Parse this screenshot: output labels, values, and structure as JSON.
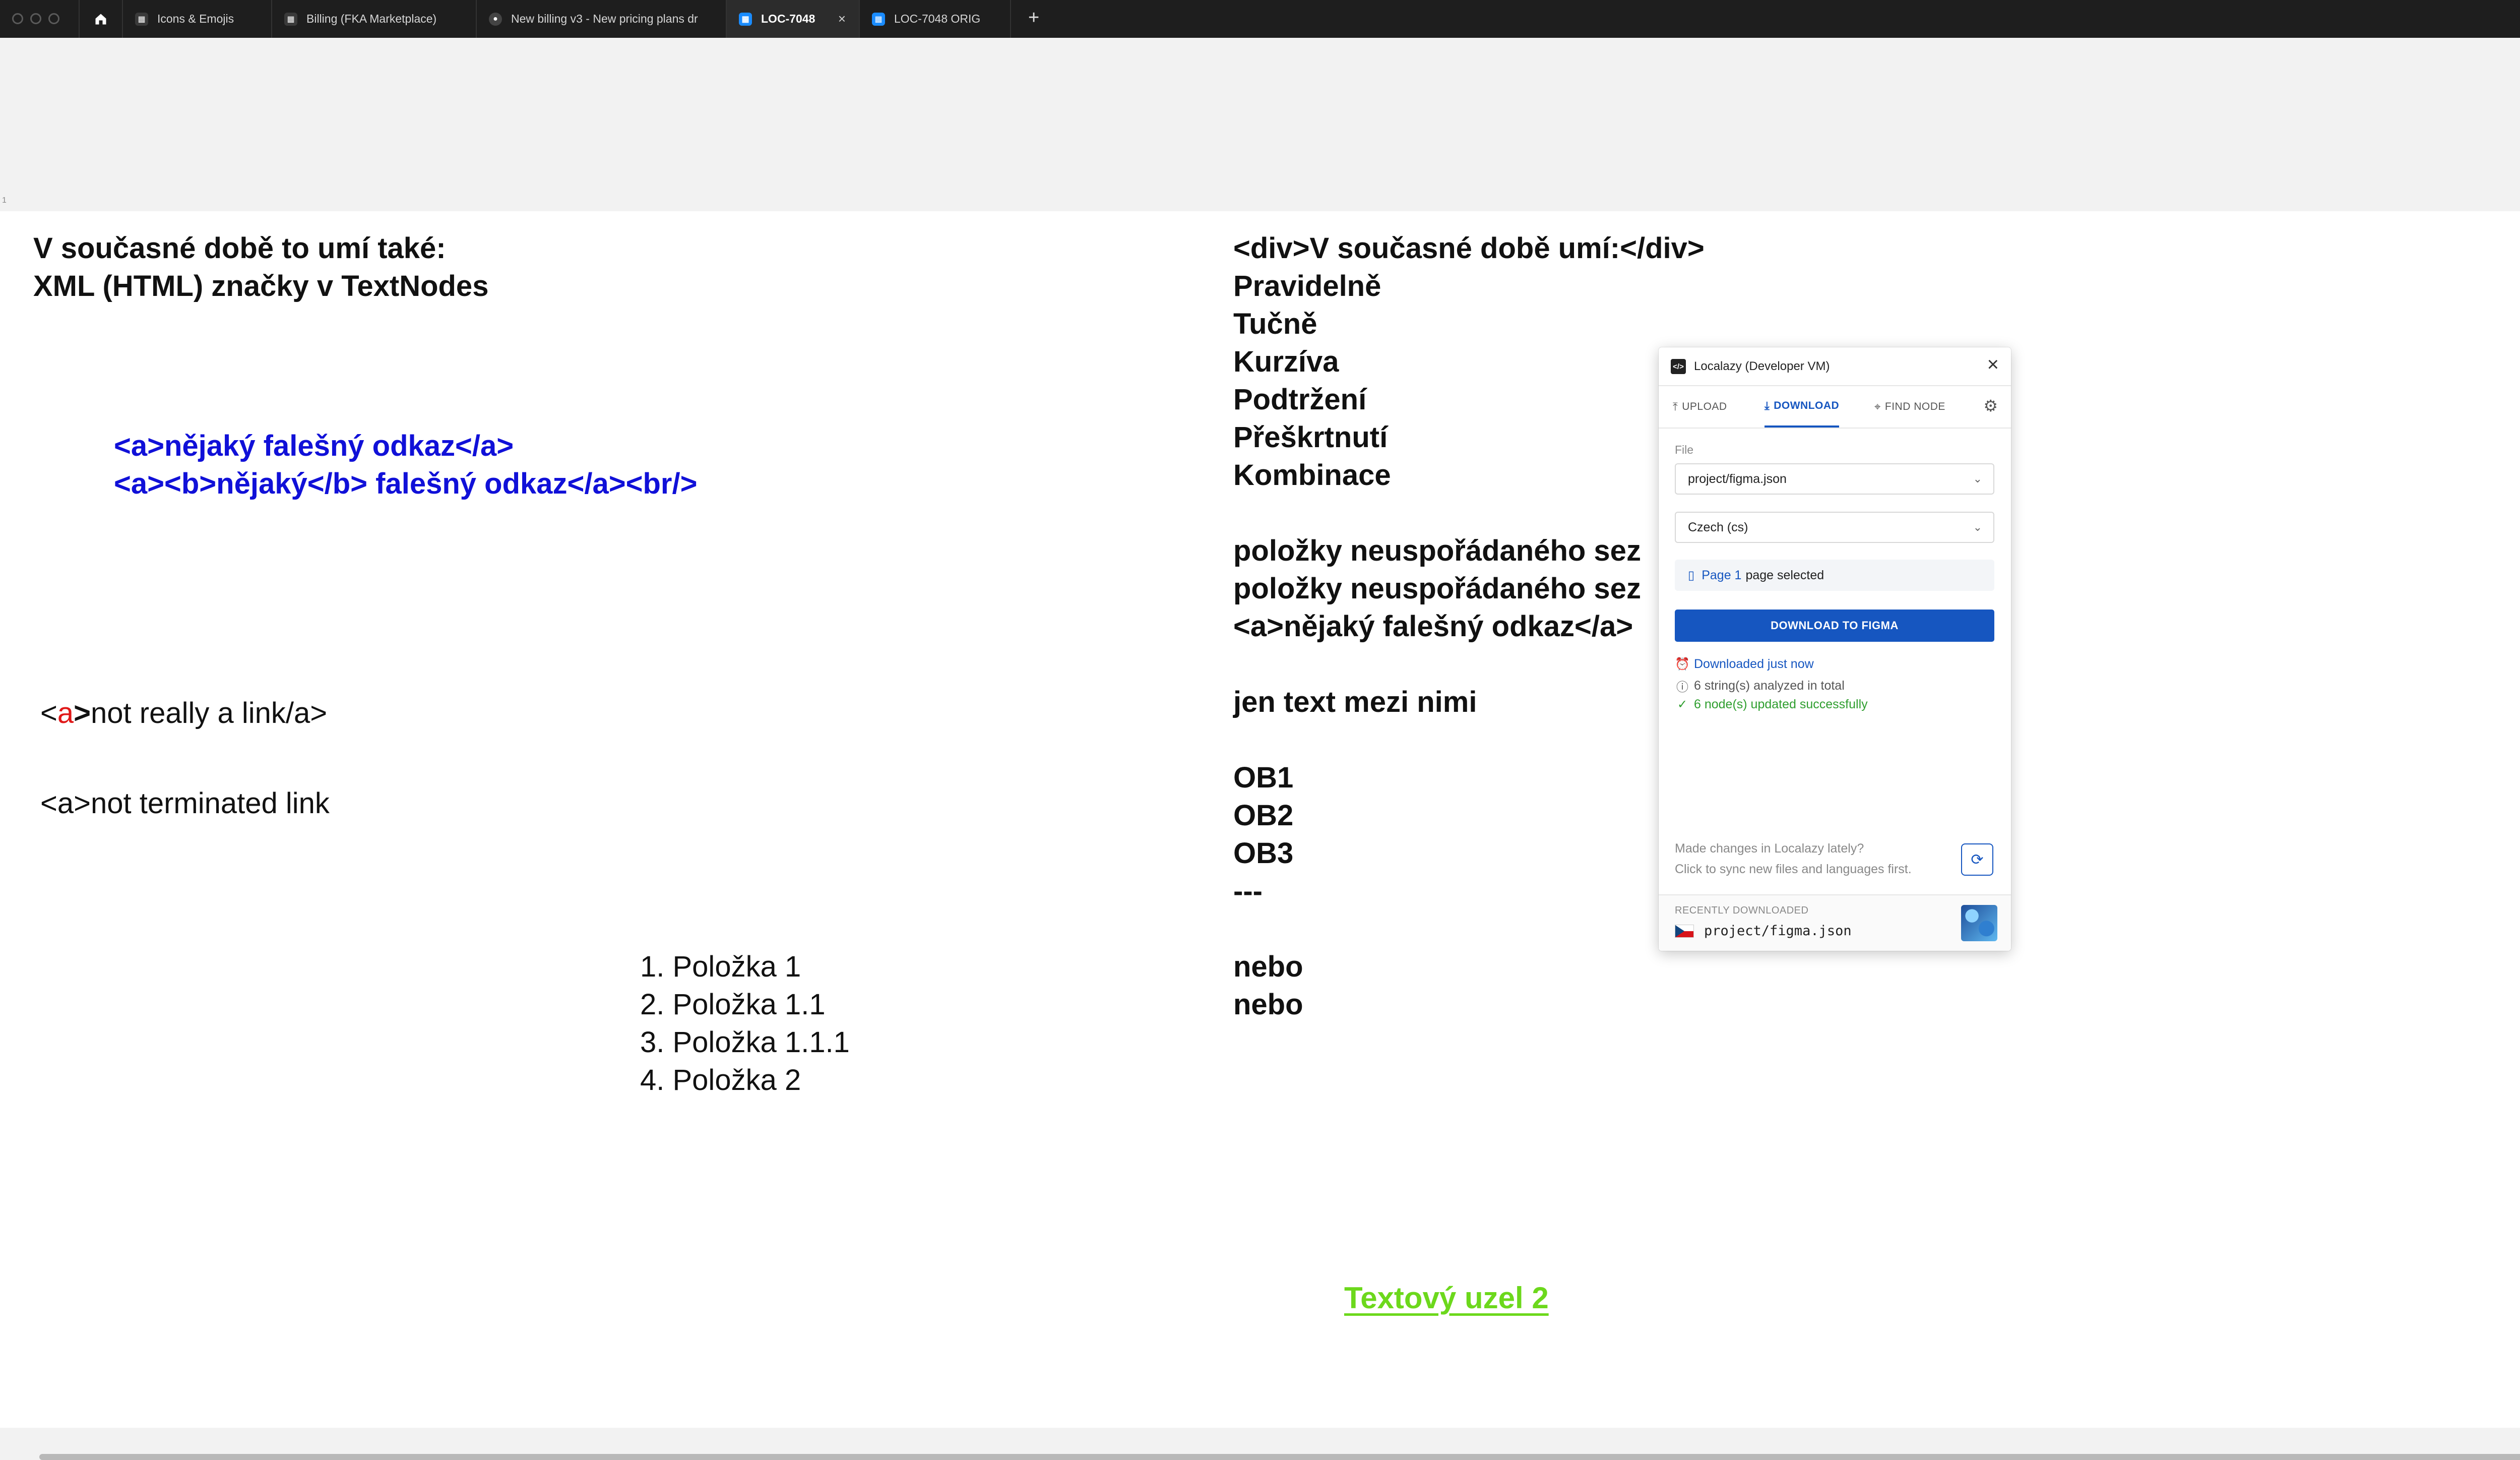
{
  "browser": {
    "tabs": [
      {
        "label": "Icons & Emojis",
        "active": false
      },
      {
        "label": "Billing (FKA Marketplace)",
        "active": false
      },
      {
        "label": "New billing v3 - New pricing plans dr",
        "active": false
      },
      {
        "label": "LOC-7048",
        "active": true
      },
      {
        "label": "LOC-7048 ORIG",
        "active": false
      }
    ],
    "new_tab": "+",
    "more": "···",
    "close": "×"
  },
  "canvas": {
    "frame_label": "1",
    "left_heading": [
      "V současné době to umí také:",
      "XML (HTML) značky v TextNodes"
    ],
    "blue_links": [
      "<a>nějaký falešný odkaz</a>",
      "<a><b>nějaký</b> falešný odkaz</a><br/>"
    ],
    "fake_link": {
      "lt": "<",
      "a": "a",
      "gt": ">",
      "rest": "not really a link/a>"
    },
    "unterminated": "<a>not terminated link",
    "ordered_list": [
      "1. Položka 1",
      "2. Položka 1.1",
      "3. Položka 1.1.1",
      "4. Položka 2"
    ],
    "right_lines": [
      "<div>V současné době umí:</div>",
      "Pravidelně",
      "Tučně",
      "Kurzíva",
      "Podtržení",
      "Přeškrtnutí",
      "Kombinace",
      "",
      "položky neuspořádaného sez",
      "položky neuspořádaného sez",
      "<a>nějaký falešný odkaz</a>",
      "",
      "jen text mezi nimi",
      "",
      "OB1",
      "OB2",
      "OB3",
      "---",
      "",
      "nebo",
      "nebo"
    ],
    "green_text": "Textový uzel 2"
  },
  "plugin": {
    "title": "Localazy (Developer VM)",
    "logo": "</>",
    "tabs": {
      "upload": "UPLOAD",
      "download": "DOWNLOAD",
      "find_node": "FIND NODE"
    },
    "file_label": "File",
    "file_value": "project/figma.json",
    "language_value": "Czech (cs)",
    "page_link": "Page 1",
    "page_suffix": "page selected",
    "download_button": "DOWNLOAD TO FIGMA",
    "status": {
      "downloaded": "Downloaded just now",
      "analyzed": "6 string(s) analyzed in total",
      "updated": "6 node(s) updated successfully"
    },
    "sync_line1": "Made changes in Localazy lately?",
    "sync_line2": "Click to sync new files and languages first.",
    "recent_label": "RECENTLY DOWNLOADED",
    "recent_file": "project/figma.json",
    "colors": {
      "accent": "#1656c0",
      "success": "#2e9e2e",
      "link_blue": "#1010d8",
      "green_text": "#6cd81c"
    }
  }
}
